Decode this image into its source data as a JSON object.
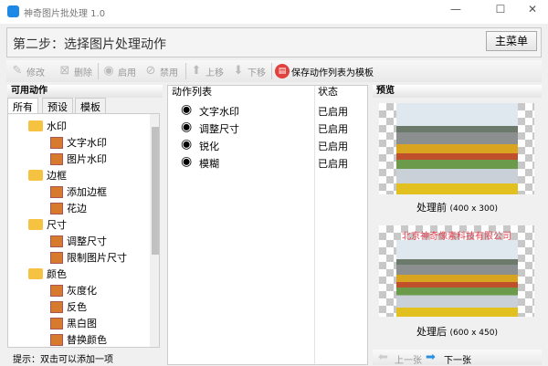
{
  "window": {
    "title": "神奇图片批处理 1.0",
    "minimize": "—",
    "maximize": "☐",
    "close": "✕"
  },
  "header": {
    "step_title": "第二步：选择图片处理动作",
    "main_menu": "主菜单"
  },
  "toolbar": {
    "edit": "修改",
    "delete": "删除",
    "enable": "启用",
    "disable": "禁用",
    "move_up": "上移",
    "move_down": "下移",
    "save_template": "保存动作列表为模板"
  },
  "left": {
    "title": "可用动作",
    "tabs": [
      "所有",
      "预设",
      "模板"
    ],
    "tree": [
      {
        "label": "水印",
        "level": 0
      },
      {
        "label": "文字水印",
        "level": 1
      },
      {
        "label": "图片水印",
        "level": 1
      },
      {
        "label": "边框",
        "level": 0
      },
      {
        "label": "添加边框",
        "level": 1
      },
      {
        "label": "花边",
        "level": 1
      },
      {
        "label": "尺寸",
        "level": 0
      },
      {
        "label": "调整尺寸",
        "level": 1
      },
      {
        "label": "限制图片尺寸",
        "level": 1
      },
      {
        "label": "颜色",
        "level": 0
      },
      {
        "label": "灰度化",
        "level": 1
      },
      {
        "label": "反色",
        "level": 1
      },
      {
        "label": "黑白图",
        "level": 1
      },
      {
        "label": "替换颜色",
        "level": 1
      }
    ],
    "hint": "提示：双击可以添加一项"
  },
  "actions": {
    "col_name": "动作列表",
    "col_status": "状态",
    "rows": [
      {
        "name": "文字水印",
        "status": "已启用"
      },
      {
        "name": "调整尺寸",
        "status": "已启用"
      },
      {
        "name": "锐化",
        "status": "已启用"
      },
      {
        "name": "模糊",
        "status": "已启用"
      }
    ]
  },
  "preview": {
    "title": "预览",
    "before": "处理前",
    "before_size": "(400 x 300)",
    "after": "处理后",
    "after_size": "(600 x 450)",
    "watermark": "北京神奇像素科技有限公司",
    "prev": "上一张",
    "next": "下一张"
  },
  "colors": {
    "accent": "#1e88e5",
    "watermark": "#e04050",
    "save_icon": "#e0413e"
  }
}
